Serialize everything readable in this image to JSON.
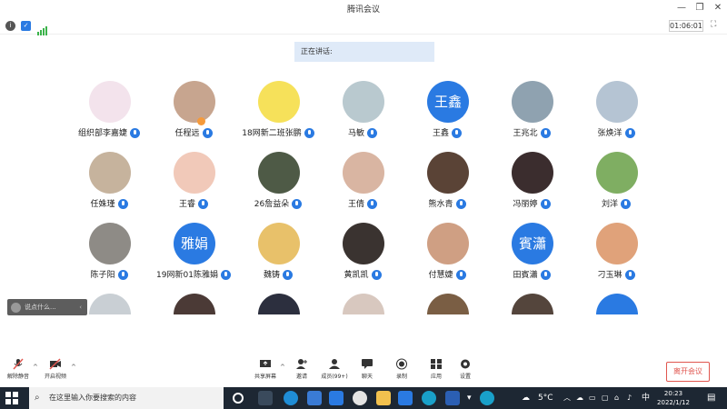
{
  "window": {
    "title": "腾讯会议"
  },
  "status": {
    "timer": "01:06:01"
  },
  "speaking_label": "正在讲话:",
  "participants": [
    {
      "name": "组织部李嘉婕",
      "avatar_color": "#f3e3ec",
      "avatar_text": ""
    },
    {
      "name": "任程远",
      "avatar_color": "#c7a58f",
      "avatar_text": ""
    },
    {
      "name": "18网新二班张鹏",
      "avatar_color": "#f6e15a",
      "avatar_text": ""
    },
    {
      "name": "马敏",
      "avatar_color": "#b9c9cf",
      "avatar_text": ""
    },
    {
      "name": "王鑫",
      "avatar_color": "#2a7ae2",
      "avatar_text": "王鑫"
    },
    {
      "name": "王兆北",
      "avatar_color": "#8fa2b0",
      "avatar_text": ""
    },
    {
      "name": "张焕洋",
      "avatar_color": "#b5c4d3",
      "avatar_text": ""
    },
    {
      "name": "任姝瑾",
      "avatar_color": "#c6b39d",
      "avatar_text": ""
    },
    {
      "name": "王睿",
      "avatar_color": "#f1c9b9",
      "avatar_text": ""
    },
    {
      "name": "26詹益朵",
      "avatar_color": "#4e5a46",
      "avatar_text": ""
    },
    {
      "name": "王倩",
      "avatar_color": "#d9b5a2",
      "avatar_text": ""
    },
    {
      "name": "熊水青",
      "avatar_color": "#5a4336",
      "avatar_text": ""
    },
    {
      "name": "冯丽婷",
      "avatar_color": "#3b2d2e",
      "avatar_text": ""
    },
    {
      "name": "刘洋",
      "avatar_color": "#7fae62",
      "avatar_text": ""
    },
    {
      "name": "陈子阳",
      "avatar_color": "#8e8b86",
      "avatar_text": ""
    },
    {
      "name": "19网新01陈雅娟",
      "avatar_color": "#2a7ae2",
      "avatar_text": "雅娟"
    },
    {
      "name": "魏铸",
      "avatar_color": "#e8c16a",
      "avatar_text": ""
    },
    {
      "name": "黄凯凯",
      "avatar_color": "#3a3330",
      "avatar_text": ""
    },
    {
      "name": "付慧婕",
      "avatar_color": "#cf9f83",
      "avatar_text": ""
    },
    {
      "name": "田賓瀟",
      "avatar_color": "#2a7ae2",
      "avatar_text": "賓瀟"
    },
    {
      "name": "刁玉琳",
      "avatar_color": "#e0a27a",
      "avatar_text": ""
    }
  ],
  "partial_avatar_colors": [
    "#c9cfd4",
    "#4b3a36",
    "#2c2f3e",
    "#d8c8bf",
    "#7a5e44",
    "#54453c",
    "#2a7ae2"
  ],
  "chat": {
    "placeholder": "说点什么..."
  },
  "toolbar": {
    "mute": "解除静音",
    "video": "开启视频",
    "share": "共享屏幕",
    "invite": "邀请",
    "members": "成员(99+)",
    "chat": "聊天",
    "record": "录制",
    "apps": "应用",
    "settings": "设置",
    "leave": "离开会议"
  },
  "taskbar": {
    "search_placeholder": "在这里输入你要搜索的内容",
    "weather": "5°C",
    "ime": "中",
    "time": "20:23",
    "date": "2022/1/12"
  },
  "colors": {
    "accent": "#2a7ae2",
    "leave": "#e0564f",
    "taskbar": "#1d2733"
  }
}
